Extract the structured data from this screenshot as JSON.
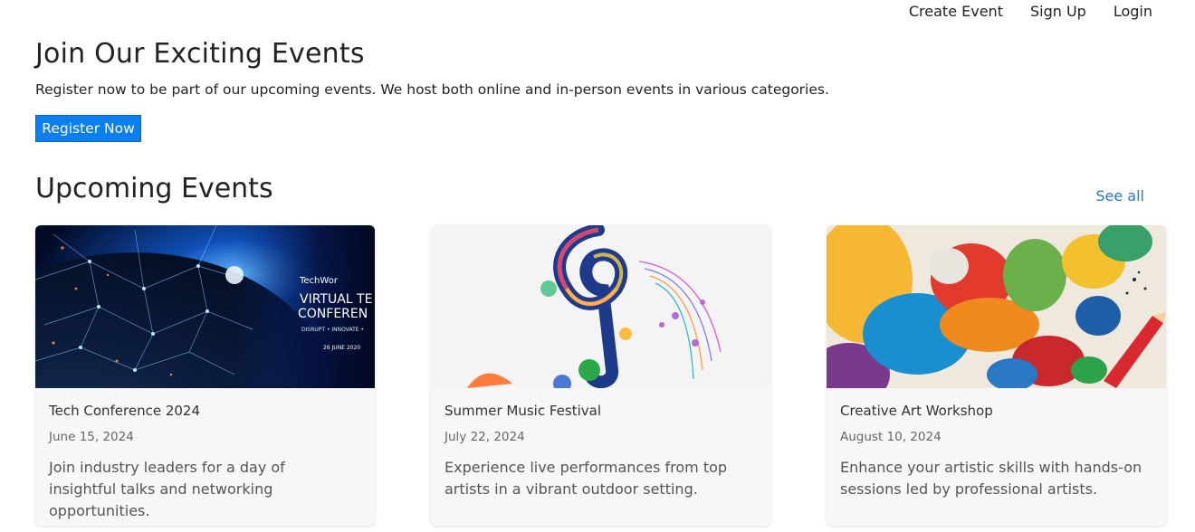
{
  "nav": {
    "create_event": "Create Event",
    "sign_up": "Sign Up",
    "login": "Login"
  },
  "hero": {
    "title": "Join Our Exciting Events",
    "subtitle": "Register now to be part of our upcoming events. We host both online and in-person events in various categories.",
    "button_label": "Register Now"
  },
  "upcoming": {
    "title": "Upcoming Events",
    "see_all": "See all",
    "events": [
      {
        "title": "Tech Conference 2024",
        "date": "June 15, 2024",
        "description": "Join industry leaders for a day of insightful talks and networking opportunities.",
        "image_text": {
          "brand": "TechWor",
          "line1": "VIRTUAL TE",
          "line2": "CONFEREN",
          "tagline": "DISRUPT • INNOVATE •",
          "date": "26 JUNE 2020"
        }
      },
      {
        "title": "Summer Music Festival",
        "date": "July 22, 2024",
        "description": "Experience live performances from top artists in a vibrant outdoor setting."
      },
      {
        "title": "Creative Art Workshop",
        "date": "August 10, 2024",
        "description": "Enhance your artistic skills with hands-on sessions led by professional artists."
      }
    ]
  },
  "colors": {
    "primary_button": "#0b7ef0",
    "link": "#2a77c9",
    "card_bg": "#f7f7f7"
  }
}
